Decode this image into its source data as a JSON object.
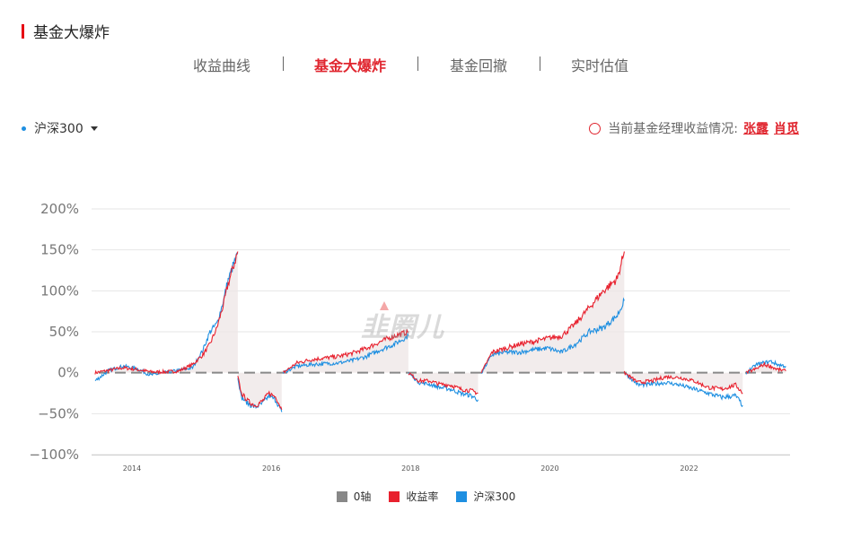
{
  "section": {
    "title": "基金大爆炸"
  },
  "tabs": [
    {
      "label": "收益曲线",
      "active": false
    },
    {
      "label": "基金大爆炸",
      "active": true
    },
    {
      "label": "基金回撤",
      "active": false
    },
    {
      "label": "实时估值",
      "active": false
    }
  ],
  "series_select": {
    "value": "沪深300"
  },
  "manager_info": {
    "label": "当前基金经理收益情况:",
    "managers": [
      "张露",
      "肖觅"
    ]
  },
  "watermark": "韭圈儿",
  "colors": {
    "accent": "#e0262f",
    "fund": "#e8212e",
    "index": "#1e8fe1",
    "zero": "#888888",
    "shade": "#ede6e6"
  },
  "chart_data": {
    "type": "line",
    "yticks": [
      "200%",
      "150%",
      "100%",
      "50%",
      "0%",
      "−50%",
      "−100%"
    ],
    "ylim": [
      -100,
      200
    ],
    "xlim": [
      2013.45,
      2023.48
    ],
    "xticks": [
      "2014",
      "2016",
      "2018",
      "2020",
      "2022"
    ],
    "legend": [
      {
        "name": "0轴",
        "color": "#888888"
      },
      {
        "name": "收益率",
        "color": "#e8212e"
      },
      {
        "name": "沪深300",
        "color": "#1e8fe1"
      }
    ],
    "segments": [
      {
        "x": [
          2013.5,
          2013.7,
          2013.9,
          2014.1,
          2014.3,
          2014.5,
          2014.7,
          2014.9,
          2015.05,
          2015.15,
          2015.25,
          2015.35,
          2015.4,
          2015.48,
          2015.55
        ],
        "fund": [
          0,
          3,
          6,
          4,
          1,
          1,
          2,
          10,
          22,
          35,
          55,
          85,
          105,
          128,
          148
        ],
        "index": [
          -10,
          3,
          8,
          5,
          -3,
          0,
          3,
          6,
          28,
          50,
          60,
          90,
          110,
          130,
          145
        ]
      },
      {
        "x": [
          2015.55,
          2015.6,
          2015.7,
          2015.8,
          2015.9,
          2016.0,
          2016.1,
          2016.18
        ],
        "fund": [
          -5,
          -25,
          -35,
          -40,
          -35,
          -25,
          -30,
          -45
        ],
        "index": [
          -5,
          -30,
          -38,
          -42,
          -38,
          -28,
          -34,
          -48
        ]
      },
      {
        "x": [
          2016.2,
          2016.4,
          2016.6,
          2016.8,
          2017.0,
          2017.2,
          2017.4,
          2017.6,
          2017.8,
          2018.0
        ],
        "fund": [
          0,
          12,
          16,
          18,
          20,
          24,
          30,
          38,
          45,
          50
        ],
        "index": [
          0,
          8,
          10,
          11,
          12,
          15,
          20,
          28,
          35,
          45
        ]
      },
      {
        "x": [
          2018.0,
          2018.15,
          2018.3,
          2018.45,
          2018.6,
          2018.75,
          2018.9,
          2019.0
        ],
        "fund": [
          0,
          -10,
          -10,
          -14,
          -15,
          -20,
          -22,
          -25
        ],
        "index": [
          0,
          -12,
          -14,
          -18,
          -20,
          -25,
          -28,
          -33
        ]
      },
      {
        "x": [
          2019.05,
          2019.2,
          2019.4,
          2019.6,
          2019.8,
          2020.0,
          2020.2,
          2020.4,
          2020.6,
          2020.8,
          2021.0,
          2021.1
        ],
        "fund": [
          0,
          25,
          30,
          35,
          38,
          42,
          45,
          60,
          80,
          100,
          115,
          148
        ],
        "index": [
          0,
          22,
          25,
          25,
          28,
          30,
          25,
          35,
          50,
          55,
          70,
          88
        ]
      },
      {
        "x": [
          2021.1,
          2021.3,
          2021.5,
          2021.7,
          2021.9,
          2022.1,
          2022.3,
          2022.5,
          2022.7,
          2022.8
        ],
        "fund": [
          0,
          -12,
          -10,
          -5,
          -6,
          -10,
          -18,
          -20,
          -15,
          -25
        ],
        "index": [
          0,
          -15,
          -14,
          -12,
          -15,
          -20,
          -25,
          -30,
          -28,
          -40
        ]
      },
      {
        "x": [
          2022.85,
          2023.0,
          2023.1,
          2023.2,
          2023.3,
          2023.42
        ],
        "fund": [
          0,
          5,
          10,
          8,
          4,
          2
        ],
        "index": [
          0,
          10,
          12,
          14,
          10,
          8
        ]
      }
    ]
  }
}
